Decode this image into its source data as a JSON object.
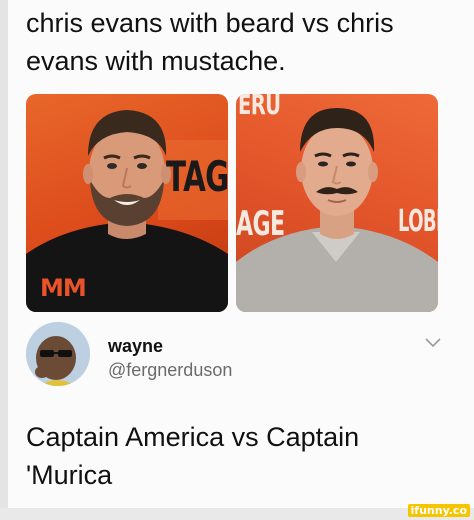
{
  "caption": {
    "text": "chris evans with beard vs chris evans with mustache."
  },
  "photos": {
    "left": {
      "backdrop_text": "TAG",
      "graphic_text": "MM"
    },
    "right": {
      "backdrop_text_top": "ERU",
      "backdrop_text_mid": "AGE",
      "backdrop_text_right": "LOBE"
    }
  },
  "tweet": {
    "name": "wayne",
    "handle": "@fergnerduson",
    "text": "Captain America vs Captain 'Murica"
  },
  "watermark": "ifunny.co",
  "colors": {
    "accent_orange": "#e2542a",
    "handle_gray": "#6b6b6b",
    "watermark_yellow": "#f7c500"
  }
}
